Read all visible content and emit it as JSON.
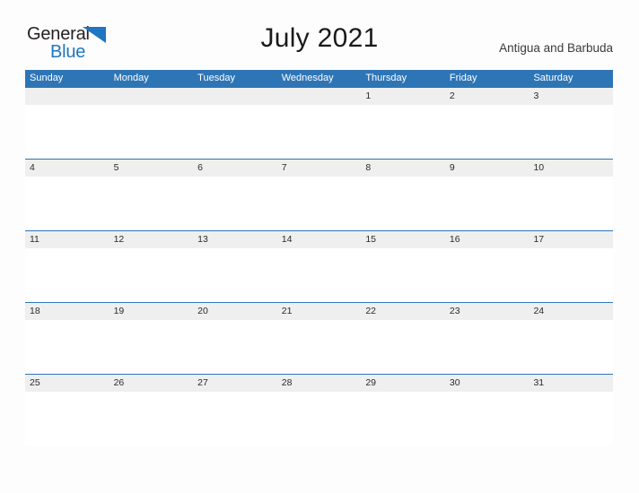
{
  "brand": {
    "name_part1": "General",
    "name_part2": "Blue",
    "flag_icon": "blue-flag-triangle-icon",
    "color_text": "#231f20",
    "color_accent": "#1f76c2"
  },
  "header": {
    "title": "July 2021",
    "country": "Antigua and Barbuda"
  },
  "calendar": {
    "header_background": "#2e75b6",
    "band_background": "#efefef",
    "border_color": "#2e75b6",
    "weekdays": [
      "Sunday",
      "Monday",
      "Tuesday",
      "Wednesday",
      "Thursday",
      "Friday",
      "Saturday"
    ],
    "weeks": [
      {
        "days": [
          "",
          "",
          "",
          "",
          "1",
          "2",
          "3"
        ]
      },
      {
        "days": [
          "4",
          "5",
          "6",
          "7",
          "8",
          "9",
          "10"
        ]
      },
      {
        "days": [
          "11",
          "12",
          "13",
          "14",
          "15",
          "16",
          "17"
        ]
      },
      {
        "days": [
          "18",
          "19",
          "20",
          "21",
          "22",
          "23",
          "24"
        ]
      },
      {
        "days": [
          "25",
          "26",
          "27",
          "28",
          "29",
          "30",
          "31"
        ]
      }
    ]
  }
}
